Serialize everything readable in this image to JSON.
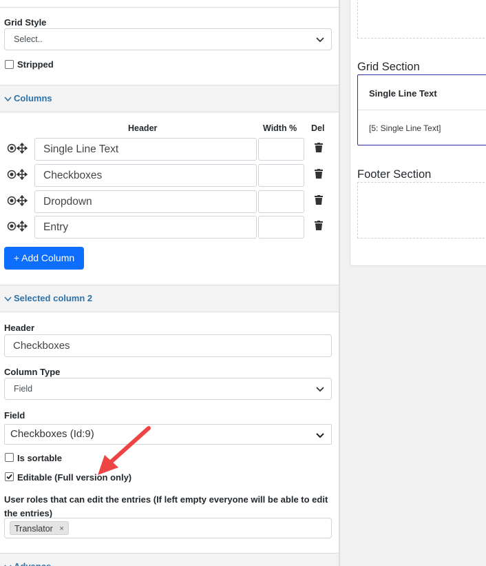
{
  "grid_style": {
    "label": "Grid Style",
    "placeholder": "Select.."
  },
  "stripped": {
    "label": "Stripped",
    "checked": false
  },
  "columns_section": {
    "label": "Columns"
  },
  "columns_table": {
    "headers": {
      "header": "Header",
      "width": "Width %",
      "del": "Del"
    },
    "rows": [
      {
        "header": "Single Line Text",
        "width": ""
      },
      {
        "header": "Checkboxes",
        "width": ""
      },
      {
        "header": "Dropdown",
        "width": ""
      },
      {
        "header": "Entry",
        "width": ""
      }
    ]
  },
  "add_column_button": {
    "label": "+ Add Column"
  },
  "selected_section": {
    "label": "Selected column 2"
  },
  "column_header": {
    "label": "Header",
    "value": "Checkboxes"
  },
  "column_type": {
    "label": "Column Type",
    "value": "Field"
  },
  "field": {
    "label": "Field",
    "value": "Checkboxes (Id:9)"
  },
  "is_sortable": {
    "label": "Is sortable",
    "checked": false
  },
  "editable": {
    "label": "Editable (Full version only)",
    "checked": true
  },
  "user_roles": {
    "label": "User roles that can edit the entries (If left empty everyone will be able to edit the entries)",
    "tags": [
      "Translator"
    ],
    "remove_glyph": "×"
  },
  "advance_section": {
    "label": "Advance"
  },
  "preview": {
    "grid_section_title": "Grid Section",
    "grid_header": "Single Line Text",
    "grid_cell": "[5: Single Line Text]",
    "footer_section_title": "Footer Section"
  },
  "colors": {
    "accent": "#2c72a8",
    "primary_button": "#0d6efd",
    "annotation_arrow": "#ef4444",
    "grid_border": "#2c2ca3"
  },
  "icons": {
    "row_handle": "target-and-move-icon",
    "delete": "trash-icon",
    "dropdown": "chevron-down-icon"
  }
}
